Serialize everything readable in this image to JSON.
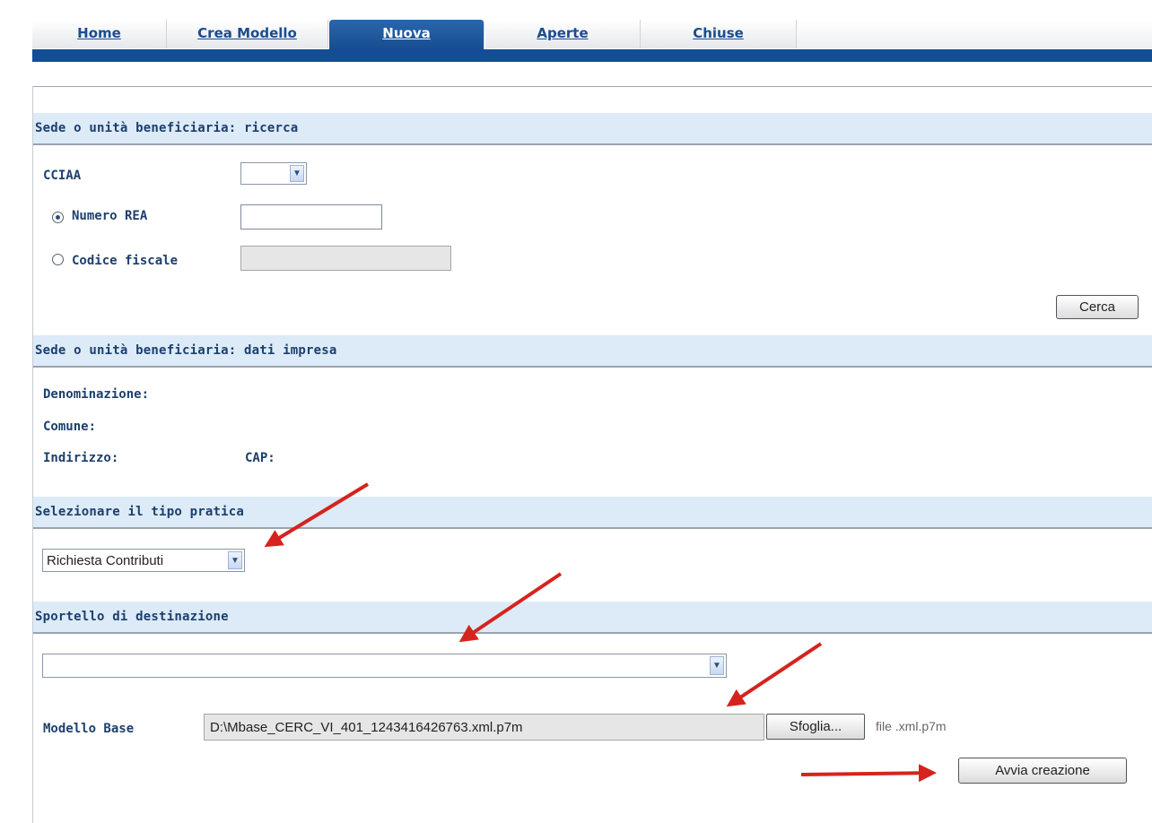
{
  "tabs": [
    {
      "label": "Home",
      "active": false
    },
    {
      "label": "Crea Modello",
      "active": false
    },
    {
      "label": "Nuova",
      "active": true
    },
    {
      "label": "Aperte",
      "active": false
    },
    {
      "label": "Chiuse",
      "active": false
    }
  ],
  "search_section": {
    "title": "Sede o unità beneficiaria: ricerca",
    "cciaa_label": "CCIAA",
    "cciaa_value": "",
    "numero_rea_label": "Numero REA",
    "numero_rea_value": "",
    "numero_rea_selected": true,
    "codice_fiscale_label": "Codice fiscale",
    "codice_fiscale_value": "",
    "codice_fiscale_selected": false,
    "search_button": "Cerca"
  },
  "company_section": {
    "title": "Sede o unità beneficiaria: dati impresa",
    "denominazione_label": "Denominazione:",
    "denominazione_value": "",
    "comune_label": "Comune:",
    "comune_value": "",
    "indirizzo_label": "Indirizzo:",
    "indirizzo_value": "",
    "cap_label": "CAP:",
    "cap_value": ""
  },
  "practice_section": {
    "title": "Selezionare il tipo pratica",
    "selected": "Richiesta Contributi"
  },
  "desk_section": {
    "title": "Sportello di destinazione",
    "selected": "",
    "modello_base_label": "Modello Base",
    "modello_base_value": "D:\\Mbase_CERC_VI_401_1243416426763.xml.p7m",
    "browse_button": "Sfoglia...",
    "file_hint": "file .xml.p7m",
    "create_button": "Avvia creazione"
  },
  "colors": {
    "tab_active": "#174c8f",
    "nav_bar": "#134d96",
    "section_header": "#dcebf7",
    "label_text": "#1d3f6e",
    "annotation_arrow": "#d7231d"
  },
  "icons": {
    "dropdown": "chevron-down-icon",
    "annotation": "red-arrow-icon"
  }
}
